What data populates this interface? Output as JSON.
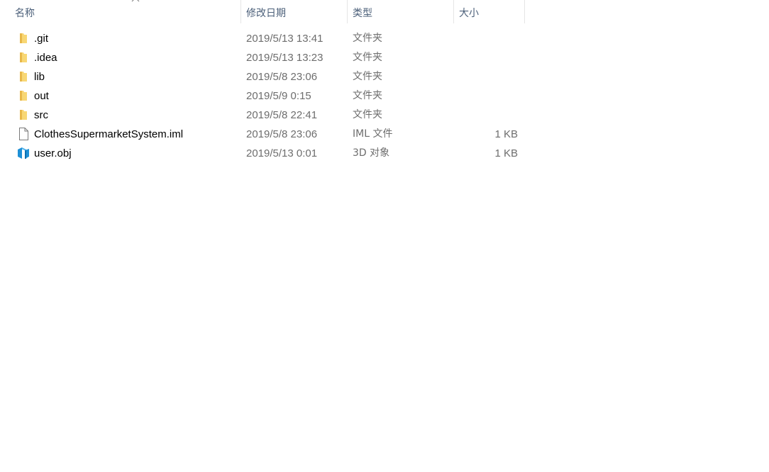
{
  "header": {
    "name": "名称",
    "date": "修改日期",
    "type": "类型",
    "size": "大小"
  },
  "files": [
    {
      "name": ".git",
      "date": "2019/5/13 13:41",
      "type": "文件夹",
      "size": "",
      "icon": "folder-icon"
    },
    {
      "name": ".idea",
      "date": "2019/5/13 13:23",
      "type": "文件夹",
      "size": "",
      "icon": "folder-icon"
    },
    {
      "name": "lib",
      "date": "2019/5/8 23:06",
      "type": "文件夹",
      "size": "",
      "icon": "folder-icon"
    },
    {
      "name": "out",
      "date": "2019/5/9 0:15",
      "type": "文件夹",
      "size": "",
      "icon": "folder-icon"
    },
    {
      "name": "src",
      "date": "2019/5/8 22:41",
      "type": "文件夹",
      "size": "",
      "icon": "folder-icon"
    },
    {
      "name": "ClothesSupermarketSystem.iml",
      "date": "2019/5/8 23:06",
      "type": "IML 文件",
      "size": "1 KB",
      "icon": "file-icon"
    },
    {
      "name": "user.obj",
      "date": "2019/5/13 0:01",
      "type": "3D 对象",
      "size": "1 KB",
      "icon": "3d-object-icon"
    }
  ],
  "colors": {
    "folder": "#f8d775",
    "folder_dark": "#e8b84a",
    "header_text": "#4c607a",
    "secondary_text": "#6d6d6d",
    "obj_blue": "#1e90d6"
  }
}
